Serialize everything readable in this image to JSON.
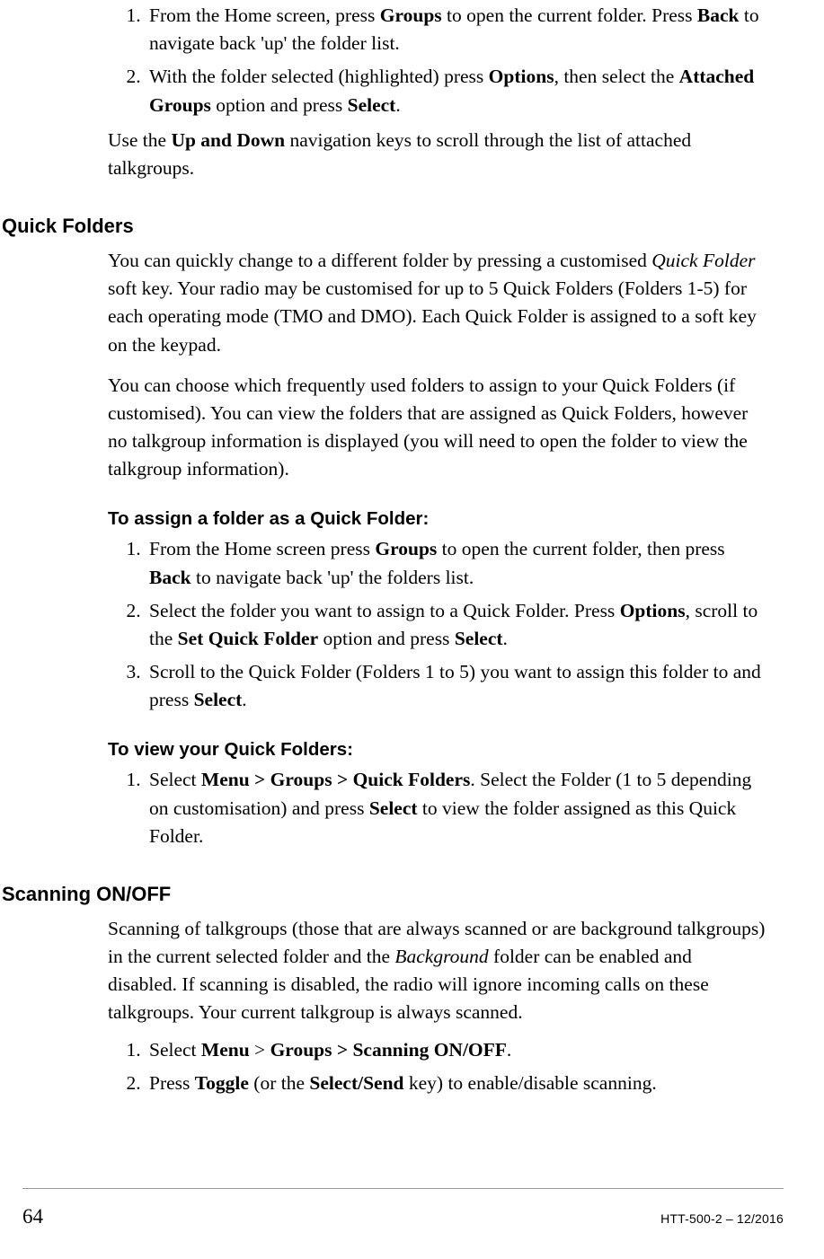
{
  "intro_list": [
    {
      "pre": "From the Home screen, press ",
      "b1": "Groups",
      "mid": " to open the current folder. Press ",
      "b2": "Back",
      "post": " to navigate back 'up' the folder list."
    },
    {
      "pre": "With the folder selected (highlighted) press ",
      "b1": "Options",
      "mid": ", then select the ",
      "b2": "Attached Groups",
      "mid2": " option and press ",
      "b3": "Select",
      "post": "."
    }
  ],
  "intro_p": {
    "pre": "Use the ",
    "b1": "Up and Down",
    "post": " navigation keys to scroll through the list of attached talkgroups."
  },
  "quick_folders": {
    "heading": "Quick Folders",
    "p1": {
      "pre": "You can quickly change to a different folder by pressing a customised ",
      "i1": "Quick Folder",
      "post": " soft key. Your radio may be customised for up to 5 Quick Folders (Folders 1-5) for each operating mode (TMO and DMO). Each Quick Folder is assigned to a soft key on the keypad."
    },
    "p2": "You can choose which frequently used folders to assign to your Quick Folders (if customised). You can view the folders that are assigned as Quick Folders, however no talkgroup information is displayed (you will need to open the folder to view the talkgroup information).",
    "assign_heading": "To assign a folder as a Quick Folder:",
    "assign_list": [
      {
        "pre": "From the Home screen press ",
        "b1": "Groups",
        "mid": " to open the current folder, then press ",
        "b2": "Back",
        "post": " to navigate back 'up' the folders list."
      },
      {
        "pre": "Select the folder you want to assign to a Quick Folder. Press ",
        "b1": "Options",
        "mid": ", scroll to the ",
        "b2": "Set Quick Folder",
        "mid2": " option and press ",
        "b3": "Select",
        "post": "."
      },
      {
        "pre": "Scroll to the Quick Folder (Folders 1 to 5) you want to assign this folder to and press ",
        "b1": "Select",
        "post": "."
      }
    ],
    "view_heading": "To view your Quick Folders:",
    "view_list": [
      {
        "pre": "Select ",
        "b1": "Menu > Groups > Quick Folders",
        "mid": ". Select the Folder (1 to 5 depending on customisation) and press ",
        "b2": "Select",
        "post": " to view the folder assigned as this Quick Folder."
      }
    ]
  },
  "scanning": {
    "heading": "Scanning ON/OFF",
    "p1": {
      "pre": "Scanning of talkgroups (those that are always scanned or are background talkgroups) in the current selected folder and the ",
      "i1": "Background",
      "post": " folder can be enabled and disabled. If scanning is disabled, the radio will ignore incoming calls on these talkgroups. Your current talkgroup is always scanned."
    },
    "list": [
      {
        "pre": "Select ",
        "b1": "Menu",
        "mid": " > ",
        "b2": "Groups > Scanning ON/OFF",
        "post": "."
      },
      {
        "pre": "Press ",
        "b1": "Toggle",
        "mid": " (or the ",
        "b2": "Select/Send",
        "post": " key) to enable/disable scanning."
      }
    ]
  },
  "footer": {
    "page": "64",
    "docid": "HTT-500-2 – 12/2016"
  }
}
